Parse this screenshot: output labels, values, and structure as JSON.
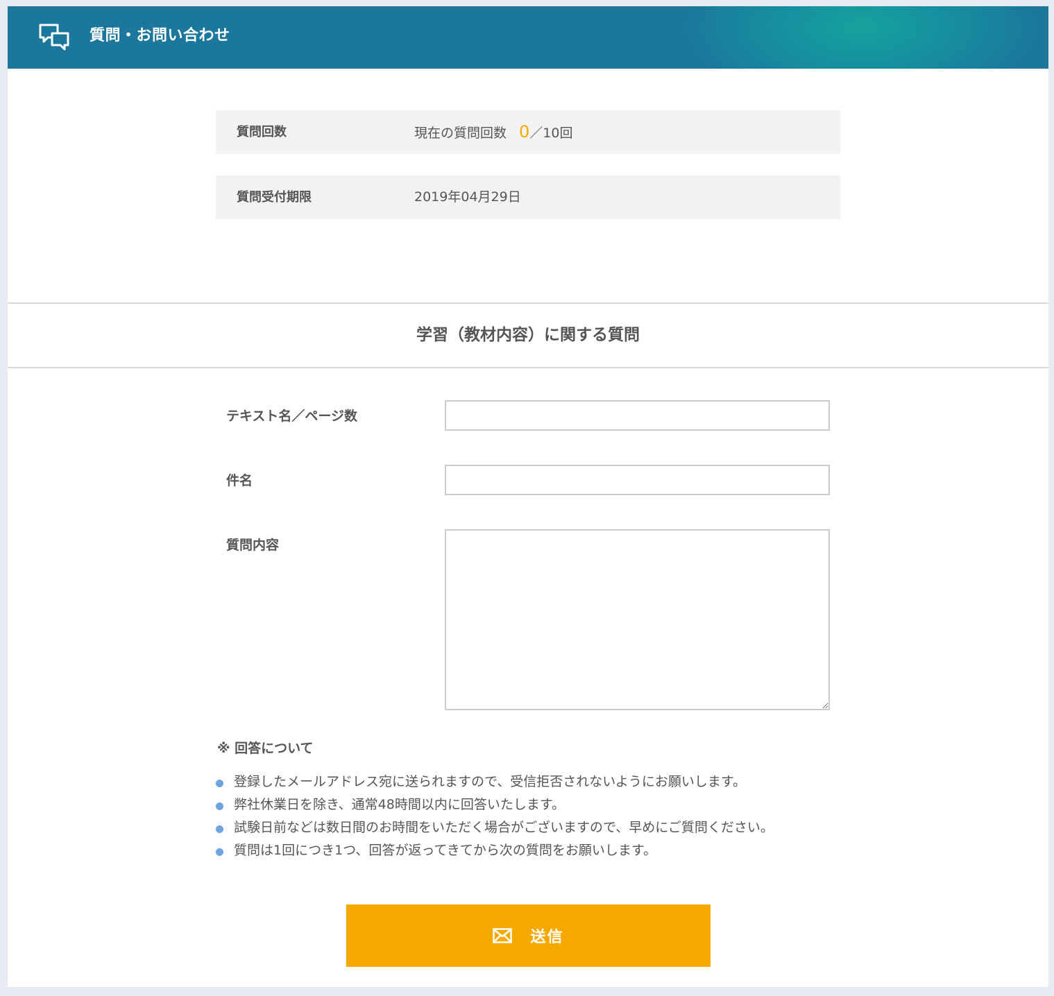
{
  "header": {
    "title": "質問・お問い合わせ",
    "icon": "chat-bubbles-icon"
  },
  "info": {
    "question_count": {
      "label": "質問回数",
      "prefix": "現在の質問回数",
      "current": "0",
      "suffix": "／10回"
    },
    "deadline": {
      "label": "質問受付期限",
      "value": "2019年04月29日"
    }
  },
  "section": {
    "title": "学習（教材内容）に関する質問"
  },
  "form": {
    "text_page": {
      "label": "テキスト名／ページ数",
      "value": "",
      "placeholder": ""
    },
    "subject": {
      "label": "件名",
      "value": "",
      "placeholder": ""
    },
    "content": {
      "label": "質問内容",
      "value": "",
      "placeholder": ""
    }
  },
  "notes": {
    "title": "※ 回答について",
    "items": [
      "登録したメールアドレス宛に送られますので、受信拒否されないようにお願いします。",
      "弊社休業日を除き、通常48時間以内に回答いたします。",
      "試験日前などは数日間のお時間をいただく場合がございますので、早めにご質問ください。",
      "質問は1回につき1つ、回答が返ってきてから次の質問をお願いします。"
    ]
  },
  "submit": {
    "label": "送信",
    "icon": "envelope-icon"
  },
  "colors": {
    "header_bg": "#1b779b",
    "header_glow": "#16a29c",
    "accent_orange": "#f5a800",
    "bullet_blue": "#6ea3e2",
    "row_bg": "#f2f2f2"
  }
}
